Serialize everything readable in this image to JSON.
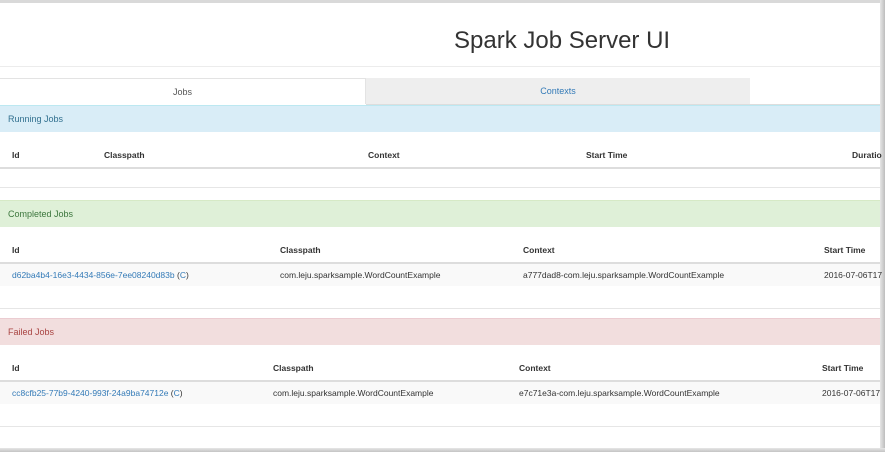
{
  "app": {
    "title": "Spark Job Server UI"
  },
  "tabs": [
    {
      "label": "Jobs",
      "active": true
    },
    {
      "label": "Contexts",
      "active": false
    }
  ],
  "running": {
    "heading": "Running Jobs",
    "columns": [
      "Id",
      "Classpath",
      "Context",
      "Start Time",
      "Duratio"
    ]
  },
  "completed": {
    "heading": "Completed Jobs",
    "columns": [
      "Id",
      "Classpath",
      "Context",
      "Start Time"
    ],
    "rows": [
      {
        "id": "d62ba4b4-16e3-4434-856e-7ee08240d83b",
        "config_link": "C",
        "classpath": "com.leju.sparksample.WordCountExample",
        "context": "a777dad8-com.leju.sparksample.WordCountExample",
        "start_time": "2016-07-06T17"
      }
    ]
  },
  "failed": {
    "heading": "Failed Jobs",
    "columns": [
      "Id",
      "Classpath",
      "Context",
      "Start Time"
    ],
    "rows": [
      {
        "id": "cc8cfb25-77b9-4240-993f-24a9ba74712e",
        "config_link": "C",
        "classpath": "com.leju.sparksample.WordCountExample",
        "context": "e7c71e3a-com.leju.sparksample.WordCountExample",
        "start_time": "2016-07-06T17"
      }
    ]
  },
  "colors": {
    "link": "#337ab7",
    "info_bg": "#d9edf7",
    "success_bg": "#dff0d8",
    "danger_bg": "#f2dede"
  }
}
